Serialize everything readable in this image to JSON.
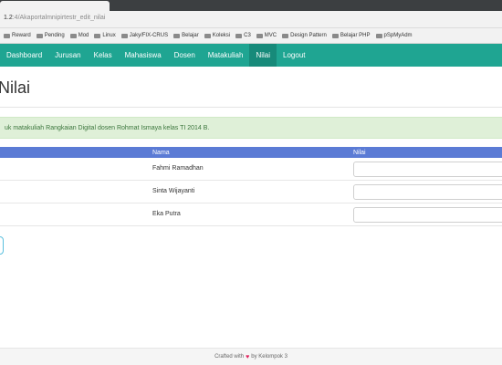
{
  "browser": {
    "url_host": "1.2",
    "url_path": ":4/Akaportalmnipirtestr_edit_nilai",
    "bookmarks": [
      "Reward",
      "Pending",
      "Mod",
      "Linux",
      "Jaky/FIX-CRUS",
      "Belajar",
      "Koleksi",
      "C3",
      "MVC",
      "Design Pattern",
      "Belajar PHP",
      "pSpMyAdm"
    ]
  },
  "navbar": {
    "items": [
      "Dashboard",
      "Jurusan",
      "Kelas",
      "Mahasiswa",
      "Dosen",
      "Matakuliah",
      "Nilai",
      "Logout"
    ],
    "active": "Nilai"
  },
  "page": {
    "title": "Nilai",
    "alert": "uk matakuliah Rangkaian Digital dosen Rohmat Ismaya kelas TI 2014 B."
  },
  "table": {
    "headers": {
      "nama": "Nama",
      "nilai": "Nilai"
    },
    "rows": [
      {
        "nama": "Fahmi Ramadhan",
        "nilai": ""
      },
      {
        "nama": "Sinta Wijayanti",
        "nilai": ""
      },
      {
        "nama": "Eka Putra",
        "nilai": ""
      }
    ]
  },
  "footer": {
    "prefix": "Crafted with",
    "suffix": "by Kelompok 3"
  },
  "colors": {
    "navbar": "#1fa592",
    "table_header": "#5b7bd5",
    "alert_bg": "#dff0d8",
    "heart": "#e0245e"
  }
}
